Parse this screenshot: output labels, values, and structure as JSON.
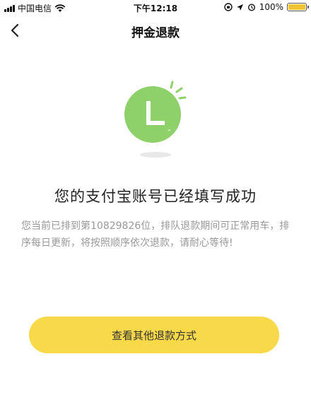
{
  "status_bar": {
    "carrier": "中国电信",
    "time": "下午12:18",
    "battery_text": "100%"
  },
  "nav": {
    "title": "押金退款"
  },
  "illustration": {
    "badge_letter": "L",
    "circle_color": "#8ed16a"
  },
  "result": {
    "title": "您的支付宝账号已经填写成功",
    "description": "您当前已排到第10829826位，排队退款期间可正常用车，排序每日更新，将按照顺序依次退款，请耐心等待!"
  },
  "actions": {
    "other_refund_label": "查看其他退款方式"
  },
  "colors": {
    "accent_yellow": "#f8d94a",
    "success_green": "#8ed16a"
  }
}
